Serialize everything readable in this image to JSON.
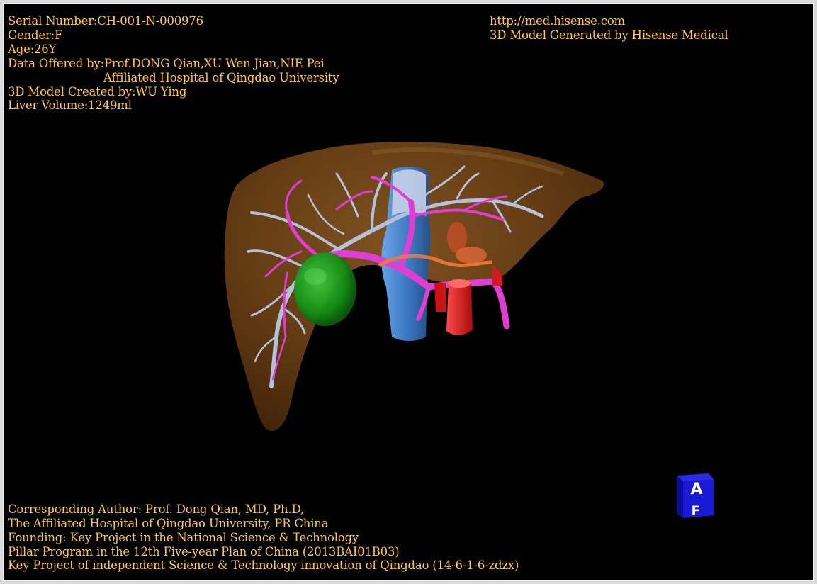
{
  "info_left": {
    "serial": "Serial Number:CH-001-N-000976",
    "gender": "Gender:F",
    "age": "Age:26Y",
    "data_offered": "Data Offered by:Prof.DONG Qian,XU Wen Jian,NIE Pei",
    "hospital": "Affiliated Hospital of Qingdao University",
    "model_created": "3D Model Created by:WU Ying",
    "liver_volume": "Liver Volume:1249ml"
  },
  "info_right": {
    "url": "http://med.hisense.com",
    "generator": "3D Model Generated by Hisense Medical"
  },
  "footer": {
    "line1": "Corresponding Author: Prof. Dong Qian, MD, Ph.D,",
    "line2": "The Affiliated Hospital of Qingdao University, PR China",
    "line3": "Founding: Key Project in the National Science & Technology",
    "line4": "Pillar Program in the 12th Five-year Plan of China (2013BAI01B03)",
    "line5": "Key Project of independent Science & Technology innovation of Qingdao (14-6-1-6-zdzx)"
  },
  "orientation_cube": {
    "top_letter": "A",
    "front_letter": "F",
    "color": "#1a1ad6"
  },
  "colors": {
    "text": "#ffc84a",
    "liver": "#7a4a1a",
    "hepatic_vein": "#b8c0d8",
    "portal_vein": "#e040d0",
    "artery": "#e01a1a",
    "vena_cava": "#4a8ad8",
    "gallbladder": "#1a9a1a"
  }
}
